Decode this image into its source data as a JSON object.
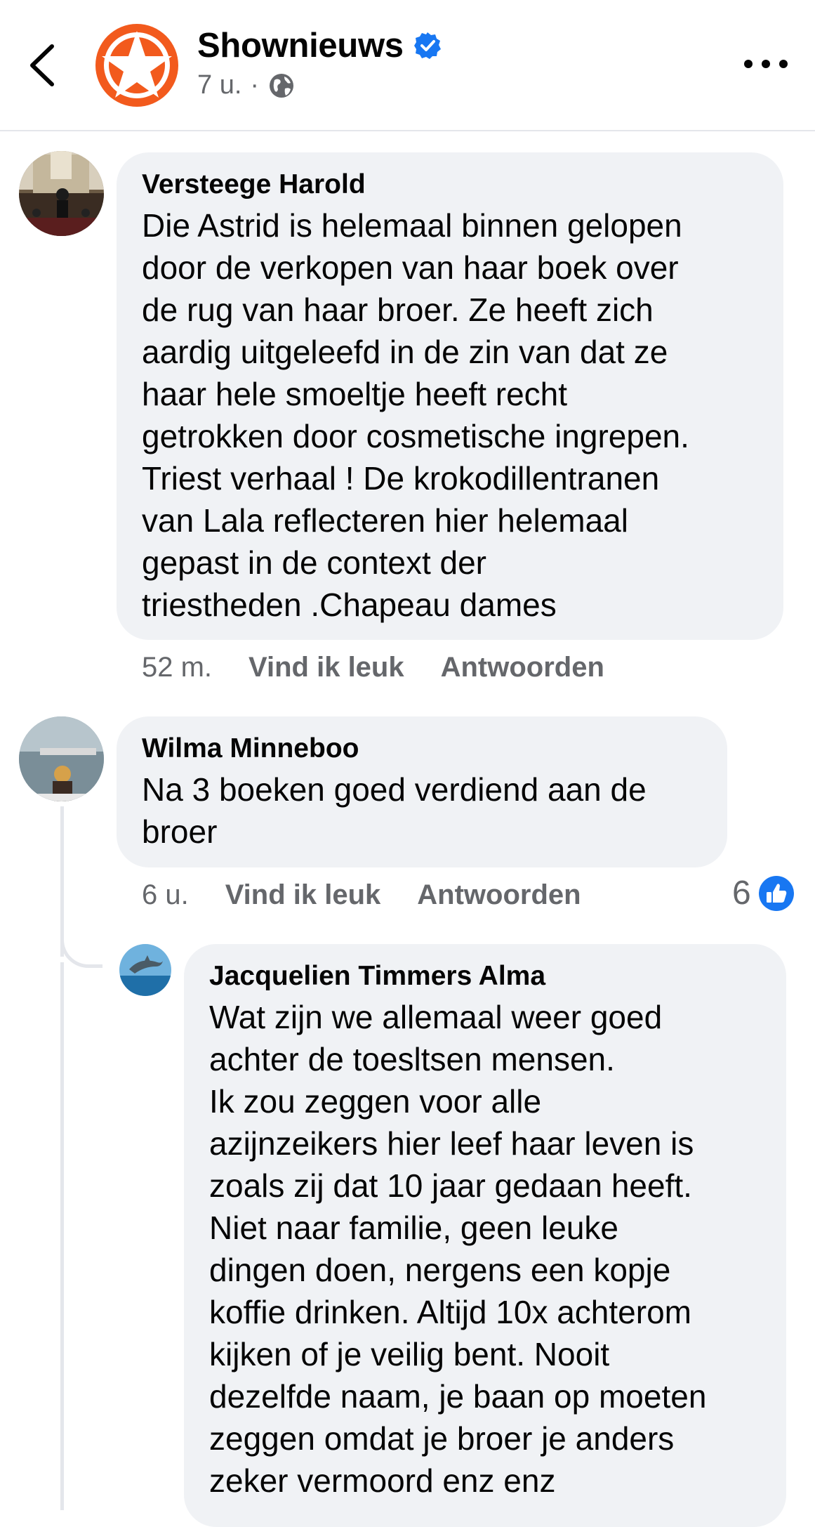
{
  "header": {
    "page_name": "Shownieuws",
    "time": "7 u.",
    "separator": "·",
    "verified_icon": "verified-badge-icon",
    "audience_icon": "globe-icon"
  },
  "colors": {
    "brand_orange": "#f25a1d",
    "verified_blue": "#1877f2",
    "bubble_bg": "#f0f2f5",
    "meta_gray": "#65676b"
  },
  "comments": [
    {
      "author": "Versteege Harold",
      "text": "Die Astrid is helemaal binnen gelopen\ndoor de verkopen van haar boek over\nde rug van haar broer. Ze heeft zich\naardig uitgeleefd in de zin van dat ze\nhaar hele smoeltje heeft recht\ngetrokken door cosmetische ingrepen.\nTriest verhaal ! De krokodillentranen\nvan Lala reflecteren hier helemaal\ngepast in de context der\ntriestheden .Chapeau dames",
      "time": "52 m.",
      "like_label": "Vind ik leuk",
      "reply_label": "Antwoorden"
    },
    {
      "author": "Wilma Minneboo",
      "text": "Na 3 boeken goed verdiend aan de\nbroer",
      "time": "6 u.",
      "like_label": "Vind ik leuk",
      "reply_label": "Antwoorden",
      "reaction_count": "6",
      "reaction_icon": "thumbs-up-icon"
    }
  ],
  "reply": {
    "author": "Jacquelien Timmers Alma",
    "text": "Wat zijn we allemaal weer goed\nachter de toesltsen mensen.\nIk zou zeggen voor alle\nazijnzeikers hier leef haar leven is\nzoals zij dat 10 jaar gedaan heeft.\nNiet naar familie, geen leuke\ndingen doen, nergens een kopje\nkoffie drinken. Altijd 10x achterom\nkijken of je veilig bent. Nooit\ndezelfde naam, je baan op moeten\nzeggen omdat je broer je anders\nzeker vermoord enz enz"
  }
}
